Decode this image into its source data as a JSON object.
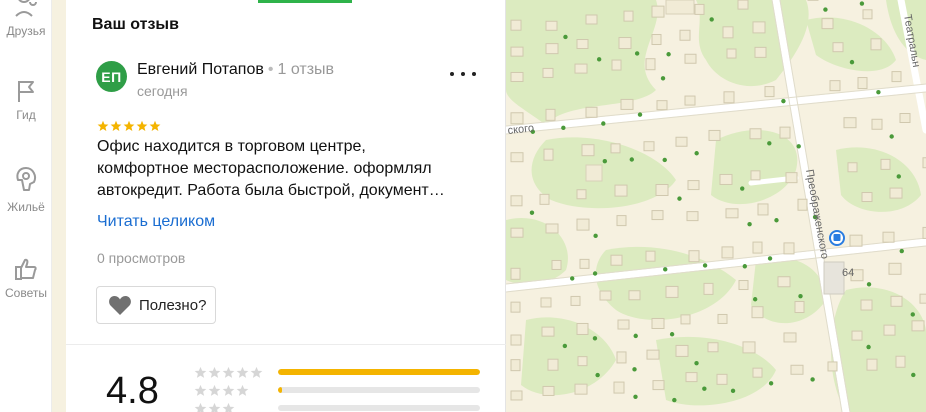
{
  "rail": {
    "items": [
      {
        "label": "Друзья",
        "icon": "friends-icon"
      },
      {
        "label": "Гид",
        "icon": "flag-icon"
      },
      {
        "label": "Жильё",
        "icon": "lodging-icon"
      },
      {
        "label": "Советы",
        "icon": "thumbs-up-icon"
      }
    ]
  },
  "review": {
    "section_title": "Ваш отзыв",
    "avatar_initials": "ЕП",
    "author": "Евгений Потапов",
    "author_reviews": "1 отзыв",
    "date": "сегодня",
    "rating": 5,
    "text_lines": [
      "Офис находится в торговом центре,",
      "комфортное месторасположение. оформлял",
      "автокредит. Работа была быстрой, документ…"
    ],
    "read_more": "Читать целиком",
    "views": "0 просмотров",
    "useful_label": "Полезно?"
  },
  "summary": {
    "rating": "4.8",
    "distribution": [
      {
        "stars": 5,
        "fraction": 1.0
      },
      {
        "stars": 4,
        "fraction": 0.02
      },
      {
        "stars": 3,
        "fraction": 0.0
      }
    ]
  },
  "map": {
    "streets": [
      "ского",
      "Преображенского",
      "Театральн"
    ],
    "house_number": "64"
  },
  "colors": {
    "accent_green": "#2fb34a",
    "avatar_green": "#2f9e47",
    "link_blue": "#1a6dd1",
    "star_yellow": "#f4b400",
    "map_base": "#f6f1e0",
    "map_park": "#dcebc0"
  }
}
